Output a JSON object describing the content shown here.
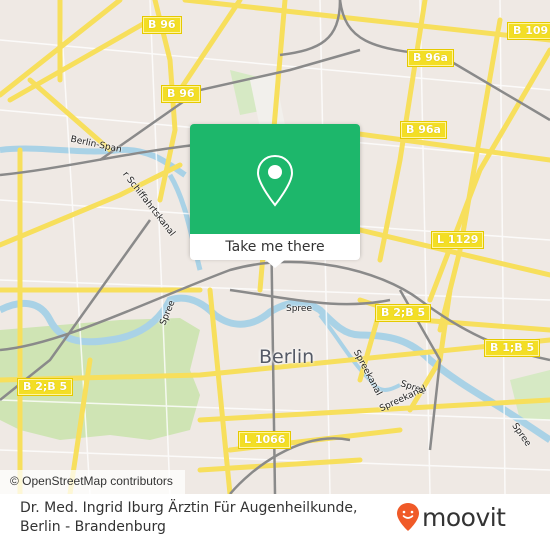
{
  "map": {
    "city_label": "Berlin",
    "road_shields": [
      {
        "id": "b96-top",
        "label": "B 96"
      },
      {
        "id": "b96-mid",
        "label": "B 96"
      },
      {
        "id": "b109",
        "label": "B 109"
      },
      {
        "id": "b96a-top",
        "label": "B 96a"
      },
      {
        "id": "b96a-mid",
        "label": "B 96a"
      },
      {
        "id": "l1129",
        "label": "L 1129"
      },
      {
        "id": "b2b5-right",
        "label": "B 2;B 5"
      },
      {
        "id": "b1b5",
        "label": "B 1;B 5"
      },
      {
        "id": "b2b5-left",
        "label": "B 2;B 5"
      },
      {
        "id": "l1066",
        "label": "L 1066"
      }
    ],
    "street_labels": [
      {
        "id": "canal-a",
        "label": "Berlin-Span"
      },
      {
        "id": "canal-b",
        "label": "r Schiffahrtskanal"
      },
      {
        "id": "spree-center",
        "label": "Spree"
      },
      {
        "id": "spree-west",
        "label": "Spree"
      },
      {
        "id": "spree-east",
        "label": "Spree"
      },
      {
        "id": "spree-southeast",
        "label": "Spree"
      },
      {
        "id": "spreekanal-center",
        "label": "Spreekanal"
      },
      {
        "id": "spreekanal-east",
        "label": "Spreekanal"
      }
    ],
    "attribution": "© OpenStreetMap contributors"
  },
  "popup": {
    "icon": "map-pin-icon",
    "action_label": "Take me there",
    "accent_color": "#1db76b"
  },
  "footer": {
    "place_line1": "Dr. Med. Ingrid Iburg Ärztin Für Augenheilkunde,",
    "place_line2": "Berlin - Brandenburg",
    "brand": "moovit",
    "brand_color": "#f05a28"
  }
}
